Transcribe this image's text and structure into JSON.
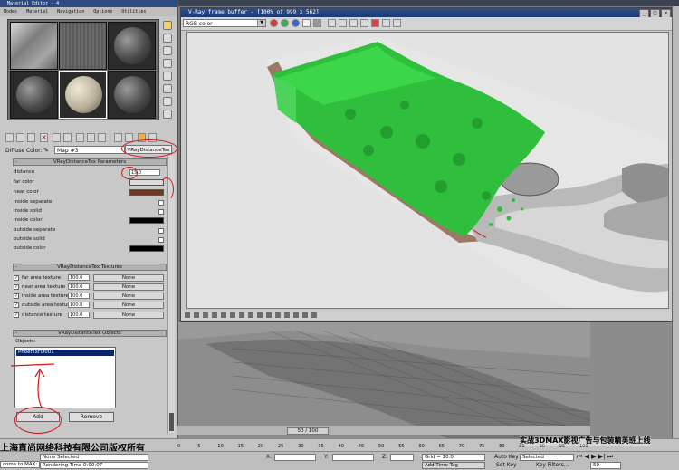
{
  "material_editor": {
    "title": "Material Editor - 4",
    "menu": [
      "Modes",
      "Material",
      "Navigation",
      "Options",
      "Utilities"
    ],
    "diffuse_label": "Diffuse Color:",
    "map_name": "Map #3",
    "map_type": "VRayDistanceTex",
    "params_header": "VRayDistanceTex Parameters",
    "params": [
      {
        "label": "distance",
        "value": "15.0"
      },
      {
        "label": "far color",
        "color": "#dcdcdc"
      },
      {
        "label": "near color",
        "color": "#6a3a22"
      },
      {
        "label": "inside separate",
        "check": false
      },
      {
        "label": "inside solid",
        "check": false
      },
      {
        "label": "inside color",
        "color": "#000000"
      },
      {
        "label": "outside separate",
        "check": false
      },
      {
        "label": "outside solid",
        "check": false
      },
      {
        "label": "outside color",
        "color": "#000000"
      }
    ],
    "textures_header": "VRayDistanceTex Textures",
    "textures": [
      {
        "label": "far area texture",
        "amount": "100.0",
        "map": "None"
      },
      {
        "label": "near area texture",
        "amount": "100.0",
        "map": "None"
      },
      {
        "label": "inside area texture",
        "amount": "100.0",
        "map": "None"
      },
      {
        "label": "outside area texture",
        "amount": "100.0",
        "map": "None"
      },
      {
        "label": "distance texture",
        "amount": "100.0",
        "map": "None"
      }
    ],
    "objects_header": "VRayDistanceTex Objects",
    "objects_label": "Objects:",
    "objects": [
      "PhoenixFD001"
    ],
    "add_label": "Add",
    "remove_label": "Remove"
  },
  "vray": {
    "title": "V-Ray frame buffer - [100% of 999 x 562]",
    "channel": "RGB color"
  },
  "timeline": {
    "frame_label": "50 / 100"
  },
  "status": {
    "selection": "None Selected",
    "render_time": "Rendering Time  0:00:07",
    "welcome": "come to MAX:",
    "x_label": "X:",
    "y_label": "Y:",
    "z_label": "Z:",
    "grid": "Grid = 10.0",
    "add_time_tag": "Add Time Tag",
    "auto_key": "Auto Key",
    "set_key": "Set Key",
    "selected_option": "Selected",
    "key_filters": "Key Filters...",
    "frame_field": "50"
  },
  "ruler_ticks": [
    "0",
    "5",
    "10",
    "15",
    "20",
    "25",
    "30",
    "35",
    "40",
    "45",
    "50",
    "55",
    "60",
    "65",
    "70",
    "75",
    "80",
    "85",
    "90",
    "95",
    "100"
  ],
  "watermarks": {
    "company": "上海直尚网络科技有限公司版权所有",
    "course": "实战3DMAX影视广告与包装精英班上线"
  },
  "colors": {
    "fluid_green": "#2fbf3c",
    "annotation_red": "#d2191c",
    "selection_blue": "#0a246a"
  },
  "icons": [
    "add-icon",
    "remove-icon",
    "sphere-icon",
    "save-image-icon",
    "clear-icon",
    "close-icon"
  ]
}
